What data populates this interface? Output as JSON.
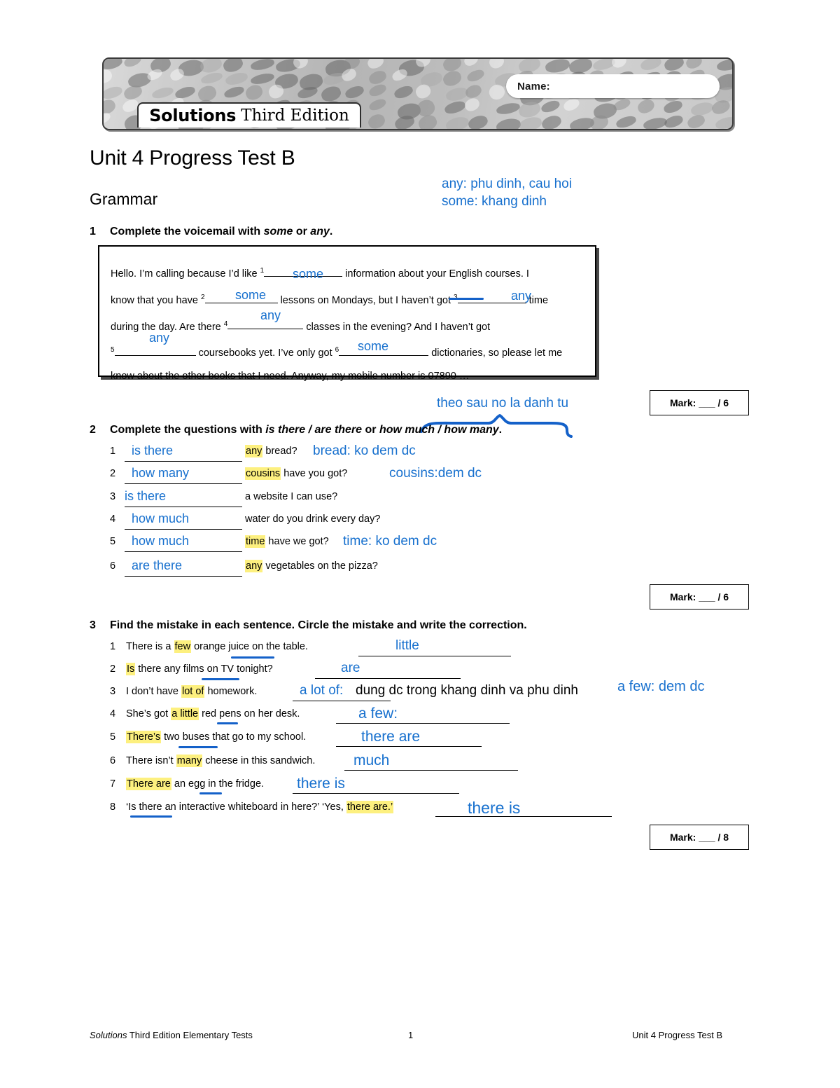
{
  "header": {
    "name_label": "Name:",
    "logo_bold": "Solutions",
    "logo_regular": "Third Edition"
  },
  "page_title": "Unit 4 Progress Test B",
  "section_title": "Grammar",
  "top_notes": "any: phu dinh, cau hoi\nsome: khang dinh",
  "accent_blue": "#1770ce",
  "highlight_yellow": "#fdf07f",
  "exercise1": {
    "number": "1",
    "instruction_pre": "Complete the voicemail with ",
    "instruction_italic1": "some",
    "instruction_mid": " or ",
    "instruction_italic2": "any",
    "instruction_end": ".",
    "text_line1a": "Hello. I’m calling because I’d like ",
    "sup1": "1",
    "text_line1b": " information about your English courses. I",
    "text_line2a": "know that you have ",
    "sup2": "2",
    "text_line2b": " lessons on Mondays, but I haven’t got ",
    "sup3": "3",
    "text_line2c": " time",
    "text_line3a": "during the day. Are there ",
    "sup4": "4",
    "text_line3b": " classes in the evening? And I haven’t got",
    "sup5": "5",
    "text_line4b": " coursebooks yet. I’ve only got ",
    "sup6": "6",
    "text_line4c": " dictionaries, so please let me",
    "text_line5": "know about the other books that I need. Anyway, my mobile number is 07890 …",
    "answers": [
      "some",
      "some",
      "any",
      "any",
      "any",
      "some"
    ],
    "mark": "Mark: ___ / 6"
  },
  "exercise2": {
    "number": "2",
    "instruction_pre": "Complete the questions with ",
    "instruction_italic1": "is there / are there",
    "instruction_mid": " or ",
    "instruction_italic2": "how much / how many",
    "instruction_end": ".",
    "brace_note": "theo sau no la danh tu",
    "items": [
      {
        "num": "1",
        "answer": "is there",
        "highlight": "any",
        "rest": "bread?",
        "note": "bread: ko dem dc"
      },
      {
        "num": "2",
        "answer": "how many",
        "highlight": "cousins",
        "rest": "have you got?",
        "note": "cousins:dem dc"
      },
      {
        "num": "3",
        "answer": "is there",
        "highlight": "",
        "rest": "a website I can use?",
        "note": ""
      },
      {
        "num": "4",
        "answer": "how much",
        "highlight": "",
        "rest": "water do you drink every day?",
        "note": ""
      },
      {
        "num": "5",
        "answer": "how much",
        "highlight": "time",
        "rest": "have we got?",
        "note": "time: ko dem dc"
      },
      {
        "num": "6",
        "answer": "are there",
        "highlight": "any",
        "rest": "vegetables on the pizza?",
        "note": ""
      }
    ],
    "mark": "Mark: ___ / 6"
  },
  "exercise3": {
    "number": "3",
    "instruction": "Find the mistake in each sentence. Circle the mistake and write the correction.",
    "items": [
      {
        "num": "1",
        "pre": "There is a ",
        "hl": "few",
        "post": " orange juice on the table.",
        "answer": "little"
      },
      {
        "num": "2",
        "pre": "",
        "hl": "Is",
        "post": " there any films on TV tonight?",
        "answer": "are"
      },
      {
        "num": "3",
        "pre": "I don’t have ",
        "hl": "lot of",
        "post": " homework.",
        "answer": "a lot of:",
        "answer_black": "dung dc trong khang dinh va phu dinh"
      },
      {
        "num": "4",
        "pre": "She’s got ",
        "hl": "a little",
        "post": " red pens on her desk.",
        "answer": "a few:"
      },
      {
        "num": "5",
        "pre": "",
        "hl": "There’s",
        "post": " two buses that go to my school.",
        "answer": "there are"
      },
      {
        "num": "6",
        "pre": "There isn’t ",
        "hl": "many",
        "post": " cheese in this sandwich.",
        "answer": "much"
      },
      {
        "num": "7",
        "pre": "",
        "hl": "There are",
        "post": " an egg in the fridge.",
        "answer": "there is"
      },
      {
        "num": "8",
        "pre": "‘Is there an interactive whiteboard in here?’ ‘Yes, ",
        "hl": "there are.’",
        "post": "",
        "answer": "there is"
      }
    ],
    "side_note": "a few: dem dc",
    "mark": "Mark: ___ / 8"
  },
  "footer": {
    "left_italic": "Solutions",
    "left_rest": " Third Edition Elementary Tests",
    "page_number": "1",
    "right": "Unit 4 Progress Test B"
  }
}
